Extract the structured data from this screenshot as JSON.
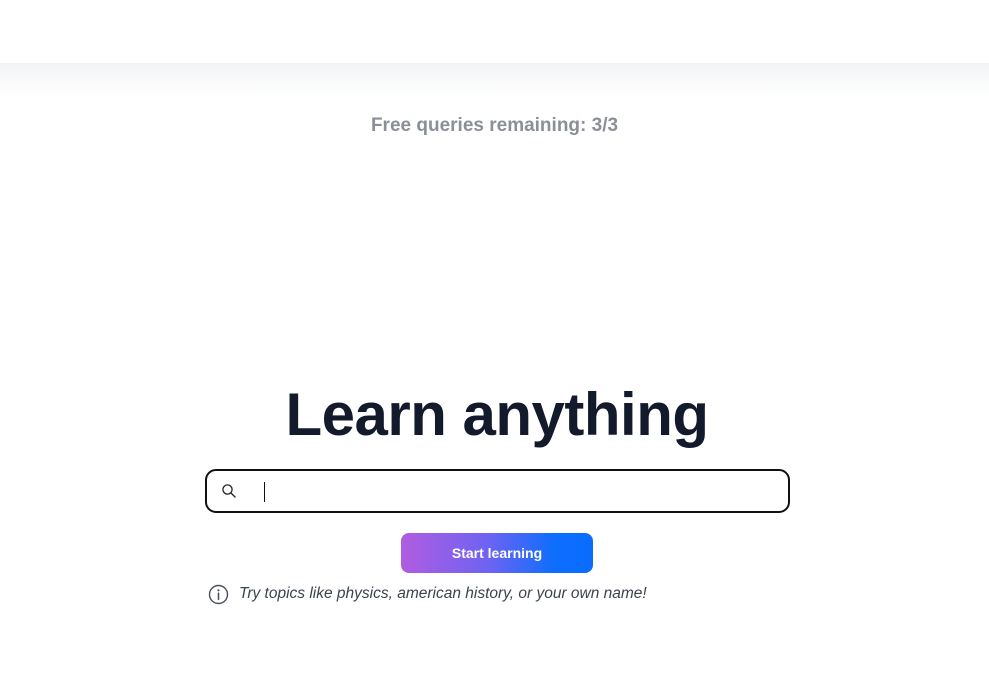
{
  "header": {
    "quota_text": "Free queries remaining: 3/3"
  },
  "hero": {
    "title": "Learn anything"
  },
  "search": {
    "value": "",
    "placeholder": "",
    "icon": "search-icon"
  },
  "actions": {
    "start_label": "Start learning"
  },
  "hint": {
    "icon": "info-icon",
    "text": "Try topics like physics, american history, or your own name!"
  },
  "colors": {
    "accent_start": "#b05ce0",
    "accent_end": "#0a6cff",
    "title": "#131a2b",
    "muted": "#8a8f98"
  }
}
